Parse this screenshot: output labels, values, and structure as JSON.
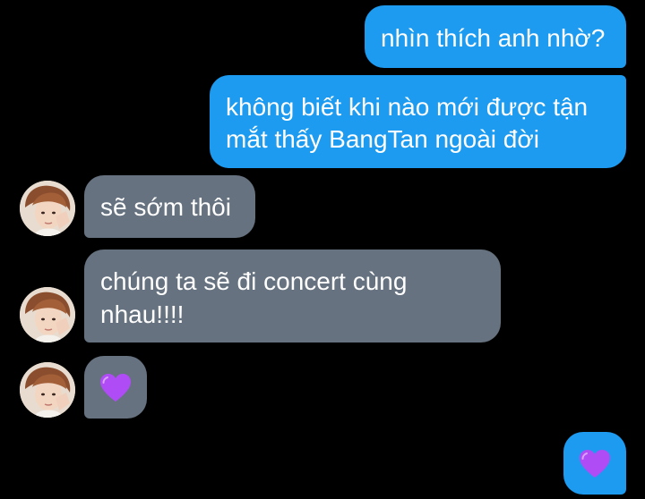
{
  "conversation": {
    "messages": [
      {
        "sender": "me",
        "text": "nhìn thích anh nhờ?"
      },
      {
        "sender": "me",
        "lines": [
          "không biết khi nào mới được tận",
          "mắt thấy BangTan ngoài đời"
        ]
      },
      {
        "sender": "friend",
        "text": "sẽ sớm thôi"
      },
      {
        "sender": "friend",
        "lines": [
          "chúng ta sẽ đi concert cùng",
          "nhau!!!!"
        ]
      },
      {
        "sender": "friend",
        "emoji": "purple-heart"
      },
      {
        "sender": "me",
        "emoji": "purple-heart"
      }
    ]
  },
  "colors": {
    "background": "#000000",
    "sent_bubble": "#1d9bf0",
    "received_bubble": "#66727f",
    "text": "#ffffff",
    "heart": "#b04cf5"
  }
}
